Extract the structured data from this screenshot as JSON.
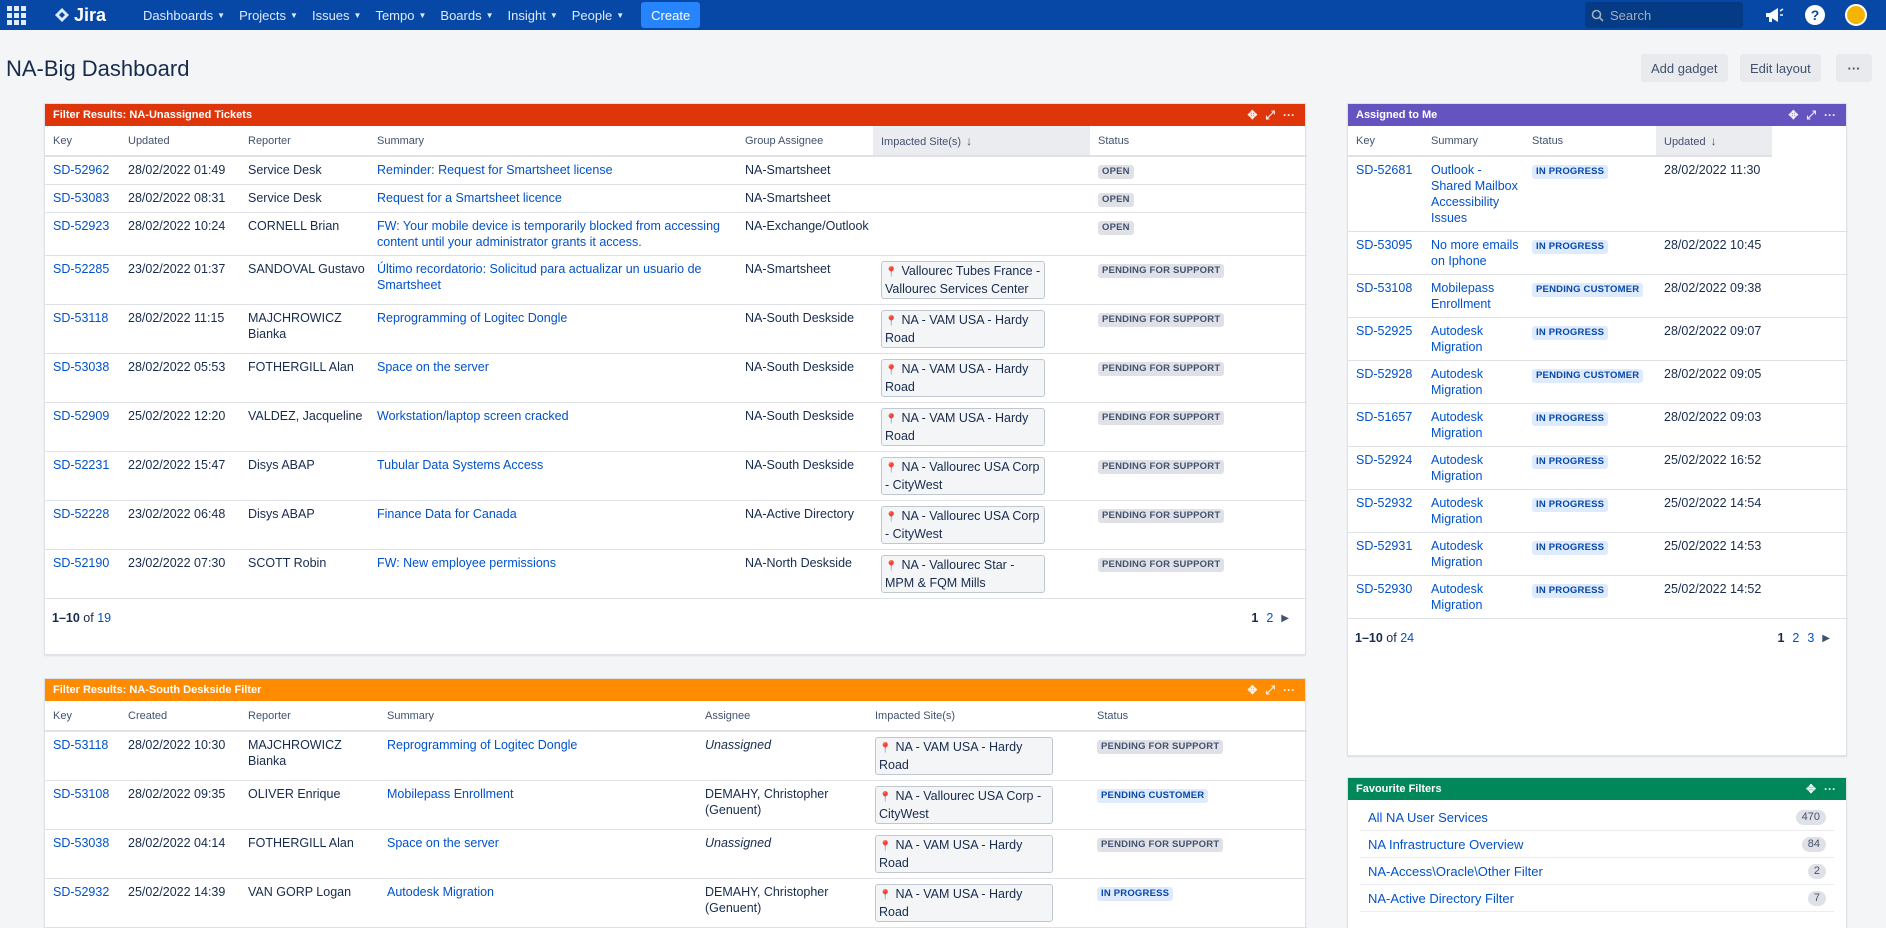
{
  "nav": {
    "logo": "Jira",
    "items": [
      "Dashboards",
      "Projects",
      "Issues",
      "Tempo",
      "Boards",
      "Insight",
      "People"
    ],
    "create": "Create",
    "search_placeholder": "Search"
  },
  "header": {
    "title": "NA-Big Dashboard",
    "add_gadget": "Add gadget",
    "edit_layout": "Edit layout",
    "more": "···"
  },
  "colors": {
    "nav": "#0747a6",
    "gadget1": "#de350b",
    "gadget2": "#ff8b00",
    "gadget3": "#6554c0",
    "gadget4": "#00875a"
  },
  "unassigned": {
    "title": "Filter Results: NA-Unassigned Tickets",
    "columns": [
      "Key",
      "Updated",
      "Reporter",
      "Summary",
      "Group Assignee",
      "Impacted Site(s)",
      "Status"
    ],
    "rows": [
      {
        "key": "SD-52962",
        "updated": "28/02/2022 01:49",
        "reporter": "Service Desk",
        "summary": "Reminder: Request for Smartsheet license",
        "group": "NA-Smartsheet",
        "site": "",
        "status": "OPEN"
      },
      {
        "key": "SD-53083",
        "updated": "28/02/2022 08:31",
        "reporter": "Service Desk",
        "summary": "Request for a Smartsheet licence",
        "group": "NA-Smartsheet",
        "site": "",
        "status": "OPEN"
      },
      {
        "key": "SD-52923",
        "updated": "28/02/2022 10:24",
        "reporter": "CORNELL Brian",
        "summary": "FW: Your mobile device is temporarily blocked from accessing content until your administrator grants it access.",
        "group": "NA-Exchange/Outlook",
        "site": "",
        "status": "OPEN"
      },
      {
        "key": "SD-52285",
        "updated": "23/02/2022 01:37",
        "reporter": "SANDOVAL Gustavo",
        "summary": "Último recordatorio: Solicitud para actualizar un usuario de Smartsheet",
        "group": "NA-Smartsheet",
        "site": "Vallourec Tubes France - Vallourec Services Center",
        "status": "PENDING FOR SUPPORT"
      },
      {
        "key": "SD-53118",
        "updated": "28/02/2022 11:15",
        "reporter": "MAJCHROWICZ Bianka",
        "summary": "Reprogramming of Logitec Dongle",
        "group": "NA-South Deskside",
        "site": "NA - VAM USA - Hardy Road",
        "status": "PENDING FOR SUPPORT"
      },
      {
        "key": "SD-53038",
        "updated": "28/02/2022 05:53",
        "reporter": "FOTHERGILL Alan",
        "summary": "Space on the server",
        "group": "NA-South Deskside",
        "site": "NA - VAM USA - Hardy Road",
        "status": "PENDING FOR SUPPORT"
      },
      {
        "key": "SD-52909",
        "updated": "25/02/2022 12:20",
        "reporter": "VALDEZ, Jacqueline",
        "summary": "Workstation/laptop screen cracked",
        "group": "NA-South Deskside",
        "site": "NA - VAM USA - Hardy Road",
        "status": "PENDING FOR SUPPORT"
      },
      {
        "key": "SD-52231",
        "updated": "22/02/2022 15:47",
        "reporter": "Disys ABAP",
        "summary": "Tubular Data Systems Access",
        "group": "NA-South Deskside",
        "site": "NA - Vallourec USA Corp - CityWest",
        "status": "PENDING FOR SUPPORT"
      },
      {
        "key": "SD-52228",
        "updated": "23/02/2022 06:48",
        "reporter": "Disys ABAP",
        "summary": "Finance Data for Canada",
        "group": "NA-Active Directory",
        "site": "NA - Vallourec USA Corp - CityWest",
        "status": "PENDING FOR SUPPORT"
      },
      {
        "key": "SD-52190",
        "updated": "23/02/2022 07:30",
        "reporter": "SCOTT Robin",
        "summary": "FW: New employee permissions",
        "group": "NA-North Deskside",
        "site": "NA - Vallourec Star - MPM & FQM Mills",
        "status": "PENDING FOR SUPPORT"
      }
    ],
    "range": "1–10",
    "of": "of",
    "total": "19",
    "pages": [
      "1",
      "2"
    ]
  },
  "southdesk": {
    "title": "Filter Results: NA-South Deskside Filter",
    "columns": [
      "Key",
      "Created",
      "Reporter",
      "Summary",
      "Assignee",
      "Impacted Site(s)",
      "Status"
    ],
    "rows": [
      {
        "key": "SD-53118",
        "created": "28/02/2022 10:30",
        "reporter": "MAJCHROWICZ Bianka",
        "summary": "Reprogramming of Logitec Dongle",
        "assignee": "Unassigned",
        "site": "NA - VAM USA - Hardy Road",
        "status": "PENDING FOR SUPPORT"
      },
      {
        "key": "SD-53108",
        "created": "28/02/2022 09:35",
        "reporter": "OLIVER Enrique",
        "summary": "Mobilepass Enrollment",
        "assignee": "DEMAHY, Christopher (Genuent)",
        "site": "NA - Vallourec USA Corp - CityWest",
        "status": "PENDING CUSTOMER"
      },
      {
        "key": "SD-53038",
        "created": "28/02/2022 04:14",
        "reporter": "FOTHERGILL Alan",
        "summary": "Space on the server",
        "assignee": "Unassigned",
        "site": "NA - VAM USA - Hardy Road",
        "status": "PENDING FOR SUPPORT"
      },
      {
        "key": "SD-52932",
        "created": "25/02/2022 14:39",
        "reporter": "VAN GORP Logan",
        "summary": "Autodesk Migration",
        "assignee": "DEMAHY, Christopher (Genuent)",
        "site": "NA - VAM USA - Hardy Road",
        "status": "IN PROGRESS"
      }
    ]
  },
  "assigned": {
    "title": "Assigned to Me",
    "columns": [
      "Key",
      "Summary",
      "Status",
      "Updated"
    ],
    "rows": [
      {
        "key": "SD-52681",
        "summary": "Outlook - Shared Mailbox Accessibility Issues",
        "status": "IN PROGRESS",
        "updated": "28/02/2022 11:30"
      },
      {
        "key": "SD-53095",
        "summary": "No more emails on Iphone",
        "status": "IN PROGRESS",
        "updated": "28/02/2022 10:45"
      },
      {
        "key": "SD-53108",
        "summary": "Mobilepass Enrollment",
        "status": "PENDING CUSTOMER",
        "updated": "28/02/2022 09:38"
      },
      {
        "key": "SD-52925",
        "summary": "Autodesk Migration",
        "status": "IN PROGRESS",
        "updated": "28/02/2022 09:07"
      },
      {
        "key": "SD-52928",
        "summary": "Autodesk Migration",
        "status": "PENDING CUSTOMER",
        "updated": "28/02/2022 09:05"
      },
      {
        "key": "SD-51657",
        "summary": "Autodesk Migration",
        "status": "IN PROGRESS",
        "updated": "28/02/2022 09:03"
      },
      {
        "key": "SD-52924",
        "summary": "Autodesk Migration",
        "status": "IN PROGRESS",
        "updated": "25/02/2022 16:52"
      },
      {
        "key": "SD-52932",
        "summary": "Autodesk Migration",
        "status": "IN PROGRESS",
        "updated": "25/02/2022 14:54"
      },
      {
        "key": "SD-52931",
        "summary": "Autodesk Migration",
        "status": "IN PROGRESS",
        "updated": "25/02/2022 14:53"
      },
      {
        "key": "SD-52930",
        "summary": "Autodesk Migration",
        "status": "IN PROGRESS",
        "updated": "25/02/2022 14:52"
      }
    ],
    "range": "1–10",
    "of": "of",
    "total": "24",
    "pages": [
      "1",
      "2",
      "3"
    ]
  },
  "favourites": {
    "title": "Favourite Filters",
    "items": [
      {
        "name": "All NA User Services",
        "count": "470"
      },
      {
        "name": "NA Infrastructure Overview",
        "count": "84"
      },
      {
        "name": "NA-Access\\Oracle\\Other Filter",
        "count": "2"
      },
      {
        "name": "NA-Active Directory Filter",
        "count": "7"
      }
    ]
  }
}
